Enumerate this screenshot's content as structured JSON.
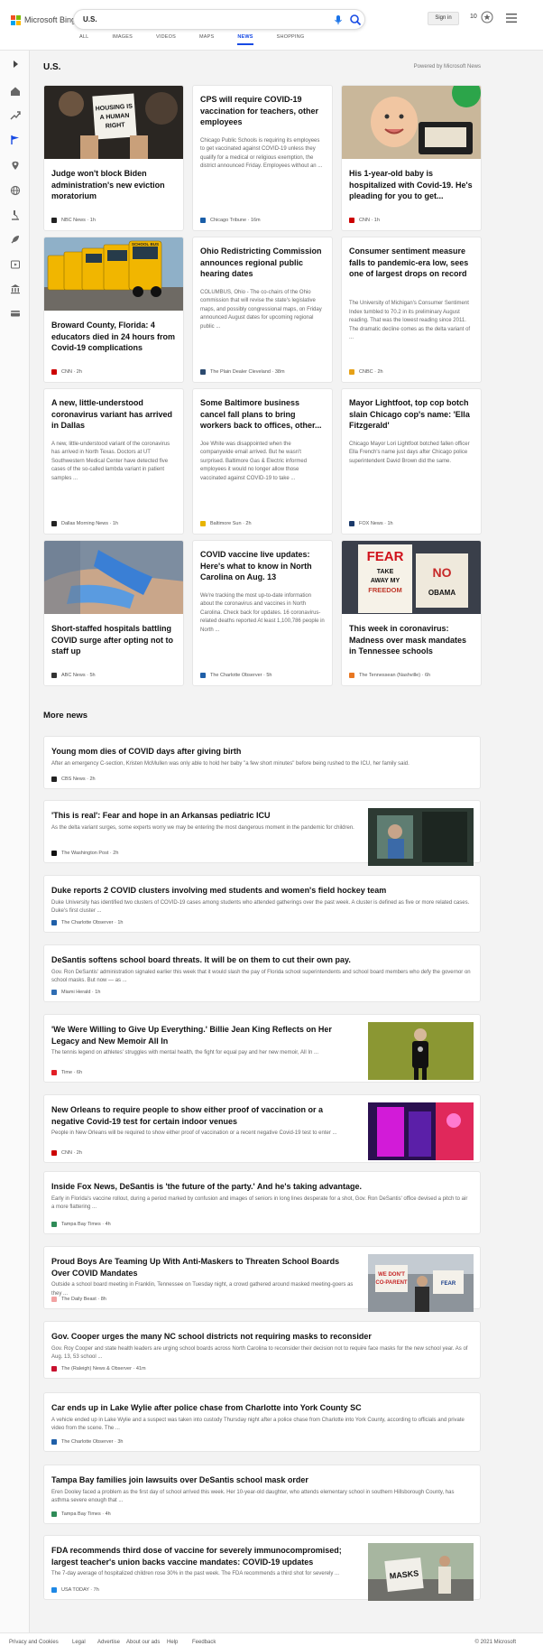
{
  "header": {
    "logo_text": "Microsoft Bing",
    "query": "U.S.",
    "signin_label": "Sign in",
    "rewards_count": "10"
  },
  "nav": {
    "tabs": [
      {
        "label": "ALL"
      },
      {
        "label": "IMAGES"
      },
      {
        "label": "VIDEOS"
      },
      {
        "label": "MAPS"
      },
      {
        "label": "NEWS",
        "active": true
      },
      {
        "label": "SHOPPING"
      }
    ]
  },
  "section": {
    "title": "U.S.",
    "powered_by": "Powered by Microsoft News"
  },
  "cards": [
    {
      "title": "Judge won't block Biden administration's new eviction moratorium",
      "desc": "",
      "source": "NBC News · 1h",
      "icon_color": "#222",
      "image": true,
      "sign_text": [
        "HOUSING IS",
        "A HUMAN",
        "RIGHT"
      ]
    },
    {
      "title": "CPS will require COVID-19 vaccination for teachers, other employees",
      "desc": "Chicago Public Schools is requiring its employees to get vaccinated against COVID-19 unless they qualify for a medical or religious exemption, the district announced Friday. Employees without an ...",
      "source": "Chicago Tribune · 16m",
      "icon_color": "#1a5ea8",
      "image": false
    },
    {
      "title": "His 1-year-old baby is hospitalized with Covid-19. He's pleading for you to get...",
      "desc": "",
      "source": "CNN · 1h",
      "icon_color": "#cc0000",
      "image": true
    },
    {
      "title": "Broward County, Florida: 4 educators died in 24 hours from Covid-19 complications",
      "desc": "",
      "source": "CNN · 2h",
      "icon_color": "#cc0000",
      "image": true
    },
    {
      "title": "Ohio Redistricting Commission announces regional public hearing dates",
      "desc": "COLUMBUS, Ohio - The co-chairs of the Ohio commission that will revise the state's legislative maps, and possibly congressional maps, on Friday announced August dates for upcoming regional public ...",
      "source": "The Plain Dealer Cleveland · 38m",
      "icon_color": "#2b4a6f",
      "image": false
    },
    {
      "title": "Consumer sentiment measure falls to pandemic-era low, sees one of largest drops on record",
      "desc": "The University of Michigan's Consumer Sentiment Index tumbled to 70.2 in its preliminary August reading. That was the lowest reading since 2011. The dramatic decline comes as the delta variant of ...",
      "source": "CNBC · 2h",
      "icon_color": "#e6a117",
      "image": false
    },
    {
      "title": "A new, little-understood coronavirus variant has arrived in Dallas",
      "desc": "A new, little-understood variant of the coronavirus has arrived in North Texas. Doctors at UT Southwestern Medical Center have detected five cases of the so-called lambda variant in patient samples ...",
      "source": "Dallas Morning News · 1h",
      "icon_color": "#222",
      "image": false
    },
    {
      "title": "Some Baltimore business cancel fall plans to bring workers back to offices, other...",
      "desc": "Joe White was disappointed when the companywide email arrived. But he wasn't surprised. Baltimore Gas & Electric informed employees it would no longer allow those vaccinated against COVID-19 to take ...",
      "source": "Baltimore Sun · 2h",
      "icon_color": "#e8b400",
      "image": false
    },
    {
      "title": "Mayor Lightfoot, top cop botch slain Chicago cop's name: 'Ella Fitzgerald'",
      "desc": "Chicago Mayor Lori Lightfoot botched fallen officer Ella French's name just days after Chicago police superintendent David Brown did the same.",
      "source": "FOX News · 1h",
      "icon_color": "#1b3a6b",
      "image": false
    },
    {
      "title": "Short-staffed hospitals battling COVID surge after opting not to staff up",
      "desc": "",
      "source": "ABC News · 5h",
      "icon_color": "#333",
      "image": true
    },
    {
      "title": "COVID vaccine live updates: Here's what to know in North Carolina on Aug. 13",
      "desc": "We're tracking the most up-to-date information about the coronavirus and vaccines in North Carolina. Check back for updates. 16 coronavirus-related deaths reported At least 1,100,786 people in North ...",
      "source": "The Charlotte Observer · 5h",
      "icon_color": "#1f5fa8",
      "image": false
    },
    {
      "title": "This week in coronavirus: Madness over mask mandates in Tennessee schools",
      "desc": "",
      "source": "The Tennessean (Nashville) · 6h",
      "icon_color": "#e87722",
      "image": true,
      "sign_text": [
        "FEAR",
        "TAKE",
        "AWAY MY",
        "FREEDOM",
        "NO",
        "OBAMA"
      ]
    }
  ],
  "bus_text": "SCHOOL BUS",
  "more": {
    "title": "More news",
    "items": [
      {
        "title": "Young mom dies of COVID days after giving birth",
        "desc": "After an emergency C-section, Kristen McMullen was only able to hold her baby \"a few short minutes\" before being rushed to the ICU, her family said.",
        "source": "CBS News · 2h",
        "icon_color": "#222",
        "thumb": false
      },
      {
        "title": "'This is real': Fear and hope in an Arkansas pediatric ICU",
        "desc": "As the delta variant surges, some experts worry we may be entering the most dangerous moment in the pandemic for children.",
        "source": "The Washington Post · 2h",
        "icon_color": "#111",
        "thumb": true
      },
      {
        "title": "Duke reports 2 COVID clusters involving med students and women's field hockey team",
        "desc": "Duke University has identified two clusters of COVID-19 cases among students who attended gatherings over the past week. A cluster is defined as five or more related cases. Duke's first cluster ...",
        "source": "The Charlotte Observer · 1h",
        "icon_color": "#1f5fa8",
        "thumb": false
      },
      {
        "title": "DeSantis softens school board threats. It will be on them to cut their own pay.",
        "desc": "Gov. Ron DeSantis' administration signaled earlier this week that it would slash the pay of Florida school superintendents and school board members who defy the governor on school masks. But now — as ...",
        "source": "Miami Herald · 1h",
        "icon_color": "#2f6db3",
        "thumb": false
      },
      {
        "title": "'We Were Willing to Give Up Everything.' Billie Jean King Reflects on Her Legacy and New Memoir All In",
        "desc": "The tennis legend on athletes' struggles with mental health, the fight for equal pay and her new memoir, All In ...",
        "source": "Time · 6h",
        "icon_color": "#e21e26",
        "thumb": true
      },
      {
        "title": "New Orleans to require people to show either proof of vaccination or a negative Covid-19 test for certain indoor venues",
        "desc": "People in New Orleans will be required to show either proof of vaccination or a recent negative Covid-19 test to enter ...",
        "source": "CNN · 2h",
        "icon_color": "#cc0000",
        "thumb": true
      },
      {
        "title": "Inside Fox News, DeSantis is 'the future of the party.' And he's taking advantage.",
        "desc": "Early in Florida's vaccine rollout, during a period marked by confusion and images of seniors in long lines desperate for a shot, Gov. Ron DeSantis' office devised a pitch to air a more flattering ...",
        "source": "Tampa Bay Times · 4h",
        "icon_color": "#2e8b57",
        "thumb": false
      },
      {
        "title": "Proud Boys Are Teaming Up With Anti-Maskers to Threaten School Boards Over COVID Mandates",
        "desc": "Outside a school board meeting in Franklin, Tennessee on Tuesday night, a crowd gathered around masked meeting-goers as they ...",
        "source": "The Daily Beast · 8h",
        "icon_color": "#f2a3a3",
        "thumb": true
      },
      {
        "title": "Gov. Cooper urges the many NC school districts not requiring masks to reconsider",
        "desc": "Gov. Roy Cooper and state health leaders are urging school boards across North Carolina to reconsider their decision not to require face masks for the new school year. As of Aug. 13, 53 school ...",
        "source": "The (Raleigh) News & Observer · 41m",
        "icon_color": "#c8102e",
        "thumb": false
      },
      {
        "title": "Car ends up in Lake Wylie after police chase from Charlotte into York County SC",
        "desc": "A vehicle ended up in Lake Wylie and a suspect was taken into custody Thursday night after a police chase from Charlotte into York County, according to officials and private video from the scene. The ...",
        "source": "The Charlotte Observer · 3h",
        "icon_color": "#1f5fa8",
        "thumb": false
      },
      {
        "title": "Tampa Bay families join lawsuits over DeSantis school mask order",
        "desc": "Eren Dooley faced a problem as the first day of school arrived this week. Her 10-year-old daughter, who attends elementary school in southern Hillsborough County, has asthma severe enough that ...",
        "source": "Tampa Bay Times · 4h",
        "icon_color": "#2e8b57",
        "thumb": false
      },
      {
        "title": "FDA recommends third dose of vaccine for severely immunocompromised; largest teacher's union backs vaccine mandates: COVID-19 updates",
        "desc": "The 7-day average of hospitalized children rose 30% in the past week. The FDA recommends a third shot for severely ...",
        "source": "USA TODAY · 7h",
        "icon_color": "#1e88e5",
        "thumb": true,
        "sign_text": "MASKS"
      }
    ]
  },
  "footer": {
    "links": [
      "Privacy and Cookies",
      "Legal",
      "Advertise",
      "About our ads",
      "Help",
      "Feedback"
    ],
    "copyright": "© 2021 Microsoft"
  }
}
